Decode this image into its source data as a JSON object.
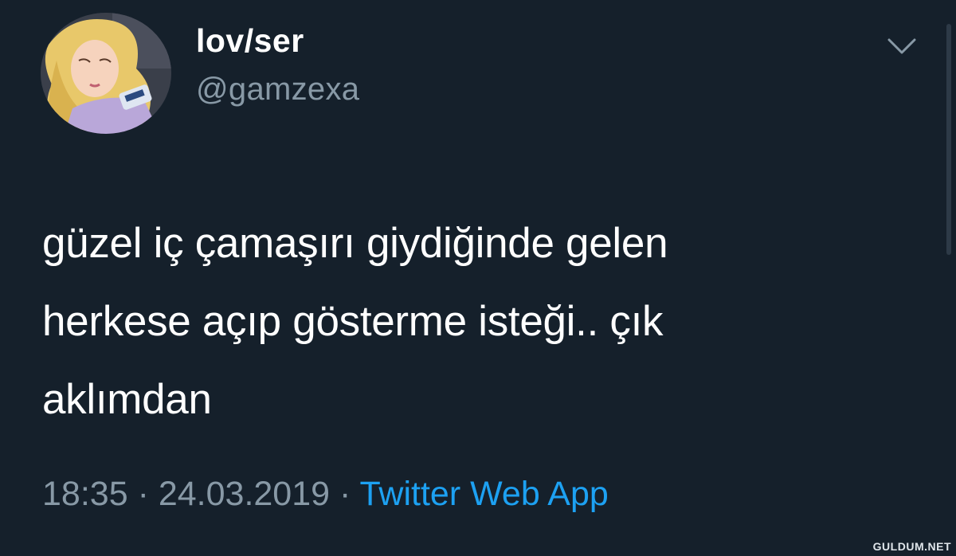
{
  "user": {
    "display_name": "lov/ser",
    "handle": "@gamzexa",
    "avatar_icon": "avatar-sleeping-princess"
  },
  "tweet": {
    "text": "güzel iç çamaşırı giydiğinde gelen\nherkese açıp gösterme isteği.. çık\naklımdan"
  },
  "meta": {
    "time": "18:35",
    "separator": "·",
    "date": "24.03.2019",
    "source": "Twitter Web App"
  },
  "watermark": "GULDUM.NET",
  "colors": {
    "background": "#15202b",
    "text": "#ffffff",
    "secondary": "#8899a6",
    "link": "#1da1f2"
  }
}
